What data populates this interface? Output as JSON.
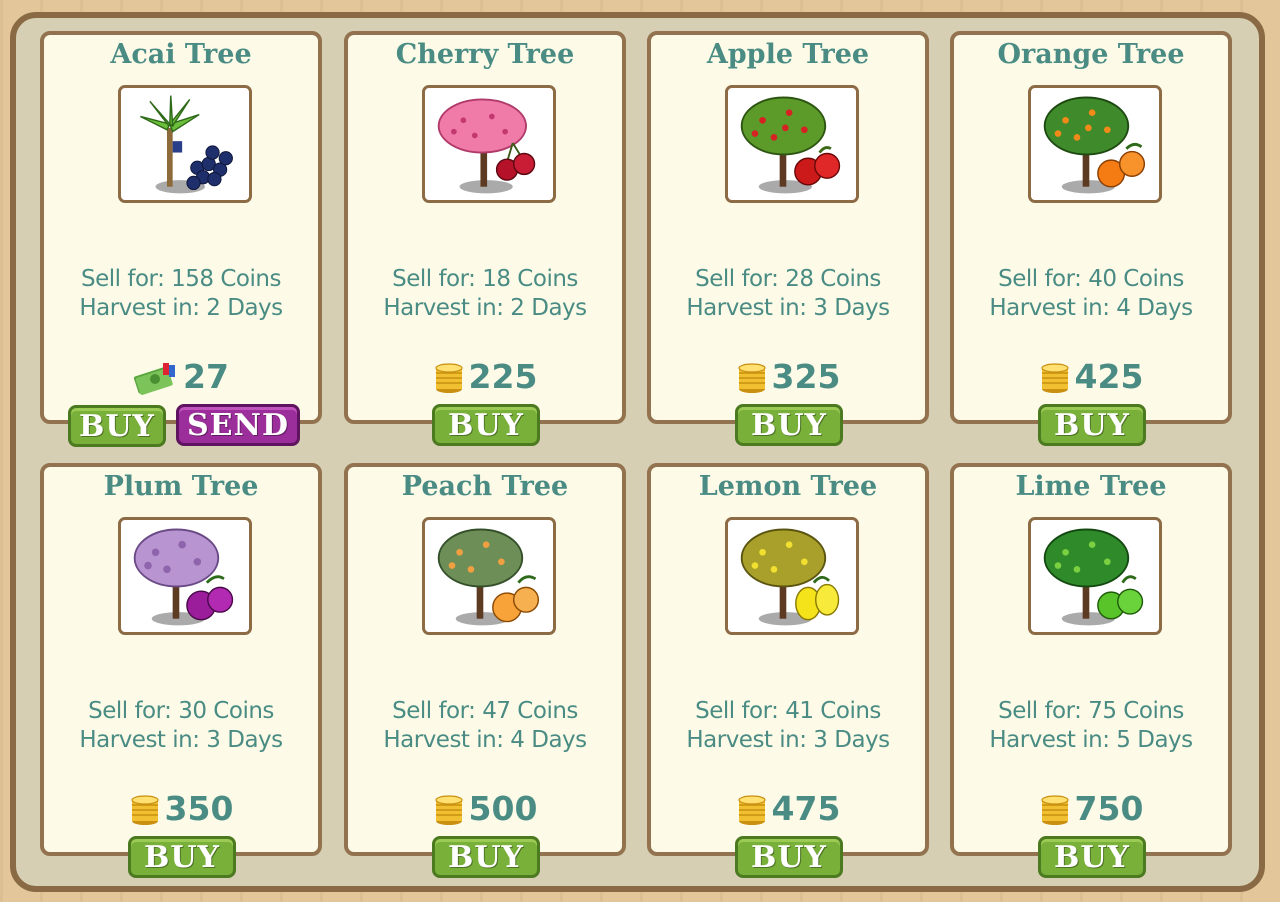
{
  "colors": {
    "accent_text": "#4a8c84",
    "buy_button": "#78b03a",
    "send_button": "#9b2e9a",
    "card_bg": "#fdfbe8",
    "frame_border": "#8a6a44"
  },
  "cards": [
    {
      "name": "Acai Tree",
      "sell": "Sell for: 158 Coins",
      "harvest": "Harvest in: 2 Days",
      "price": "27",
      "currency_icon": "cash-icon",
      "buy_label": "BUY",
      "send_label": "SEND"
    },
    {
      "name": "Cherry Tree",
      "sell": "Sell for: 18 Coins",
      "harvest": "Harvest in: 2 Days",
      "price": "225",
      "currency_icon": "coin-icon",
      "buy_label": "BUY"
    },
    {
      "name": "Apple Tree",
      "sell": "Sell for: 28 Coins",
      "harvest": "Harvest in: 3 Days",
      "price": "325",
      "currency_icon": "coin-icon",
      "buy_label": "BUY"
    },
    {
      "name": "Orange Tree",
      "sell": "Sell for: 40 Coins",
      "harvest": "Harvest in: 4 Days",
      "price": "425",
      "currency_icon": "coin-icon",
      "buy_label": "BUY"
    },
    {
      "name": "Plum Tree",
      "sell": "Sell for: 30 Coins",
      "harvest": "Harvest in: 3 Days",
      "price": "350",
      "currency_icon": "coin-icon",
      "buy_label": "BUY"
    },
    {
      "name": "Peach Tree",
      "sell": "Sell for: 47 Coins",
      "harvest": "Harvest in: 4 Days",
      "price": "500",
      "currency_icon": "coin-icon",
      "buy_label": "BUY"
    },
    {
      "name": "Lemon Tree",
      "sell": "Sell for: 41 Coins",
      "harvest": "Harvest in: 3 Days",
      "price": "475",
      "currency_icon": "coin-icon",
      "buy_label": "BUY"
    },
    {
      "name": "Lime Tree",
      "sell": "Sell for: 75 Coins",
      "harvest": "Harvest in: 5 Days",
      "price": "750",
      "currency_icon": "coin-icon",
      "buy_label": "BUY"
    }
  ]
}
